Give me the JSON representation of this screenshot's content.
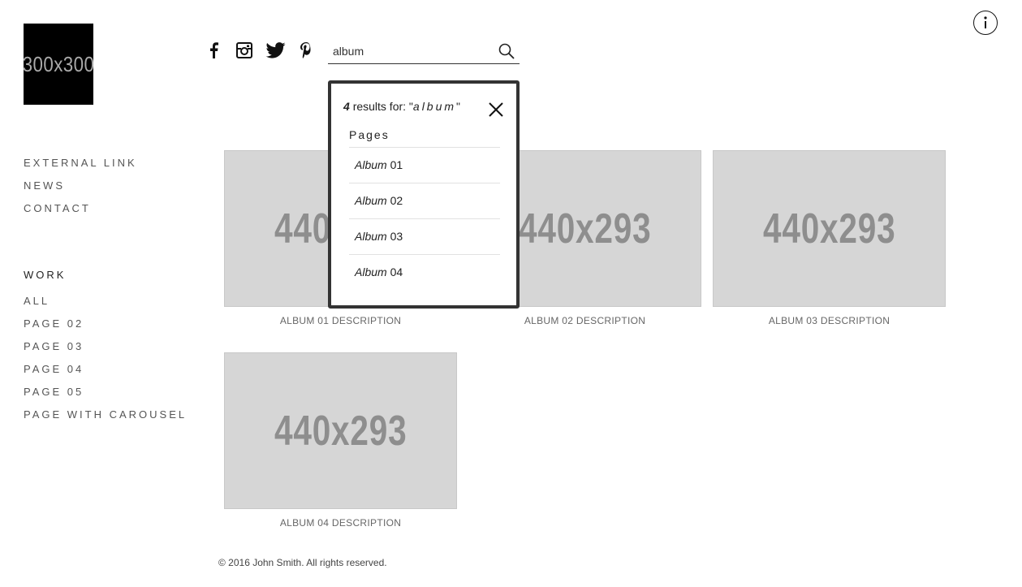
{
  "logo": {
    "text": "300x300"
  },
  "nav": {
    "links": [
      "EXTERNAL LINK",
      "NEWS",
      "CONTACT"
    ],
    "work_heading": "WORK",
    "work_links": [
      "ALL",
      "PAGE 02",
      "PAGE 03",
      "PAGE 04",
      "PAGE 05",
      "PAGE WITH CAROUSEL"
    ]
  },
  "social": {
    "icons": [
      "facebook-icon",
      "instagram-icon",
      "twitter-icon",
      "pinterest-icon"
    ]
  },
  "search": {
    "value": "album",
    "icon": "search-icon"
  },
  "info": {
    "icon": "info-icon"
  },
  "search_results": {
    "count": "4",
    "label": "results for: \"",
    "query": "album",
    "quote_close": "\"",
    "section": "Pages",
    "items": [
      {
        "highlight": "Album",
        "rest": " 01"
      },
      {
        "highlight": "Album",
        "rest": " 02"
      },
      {
        "highlight": "Album",
        "rest": " 03"
      },
      {
        "highlight": "Album",
        "rest": " 04"
      }
    ]
  },
  "albums": [
    {
      "placeholder": "440x293",
      "caption": "ALBUM 01 DESCRIPTION"
    },
    {
      "placeholder": "440x293",
      "caption": "ALBUM 02 DESCRIPTION"
    },
    {
      "placeholder": "440x293",
      "caption": "ALBUM 03 DESCRIPTION"
    },
    {
      "placeholder": "440x293",
      "caption": "ALBUM 04 DESCRIPTION"
    }
  ],
  "footer": {
    "copyright": "© 2016 John Smith. All rights reserved."
  },
  "colors": {
    "logo_bg": "#000000",
    "thumb_bg": "#d6d6d6",
    "thumb_text": "#8e8e8e",
    "popup_border": "#333333"
  }
}
